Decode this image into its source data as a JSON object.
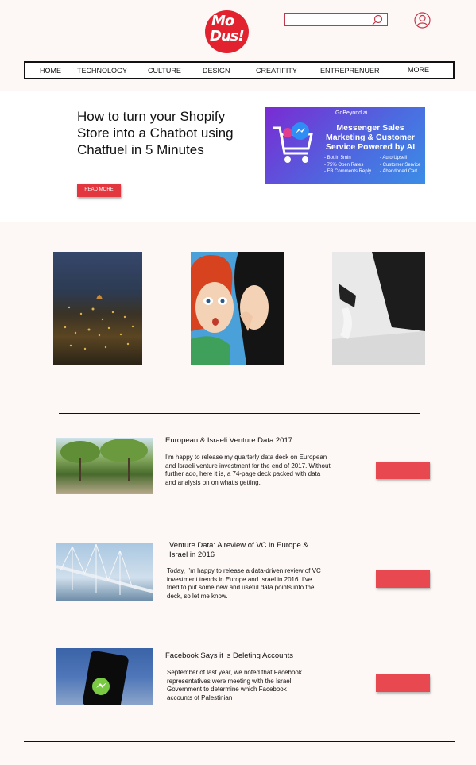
{
  "logo": {
    "line1": "Mo",
    "line2": "Dus!"
  },
  "search": {
    "placeholder": "",
    "value": ""
  },
  "nav": {
    "items": [
      "HOME",
      "TECHNOLOGY",
      "CULTURE",
      "DESIGN",
      "CREATIFITY",
      "ENTREPRENUER",
      "MORE"
    ]
  },
  "hero": {
    "title": "How to turn your Shopify Store into a Chatbot using Chatfuel in 5 Minutes",
    "read_more": "READ MORE",
    "promo": {
      "brand": "GoBeyond.ai",
      "headline": "Messenger Sales Marketing & Customer Service Powered by AI",
      "features_left": [
        "- Bot in 5min",
        "- 75% Open Rates",
        "- FB Comments Reply"
      ],
      "features_right": [
        "- Auto Upsell",
        "- Customer Service",
        "- Abandoned Cart"
      ]
    }
  },
  "articles": [
    {
      "title": "European & Israeli Venture Data 2017",
      "body": "I’m happy to release my quarterly data deck on European and Israeli venture investment for the end of 2017. Without further ado, here it is, a 74-page deck packed with data and analysis on on what's getting."
    },
    {
      "title": "Venture Data: A review of VC in Europe & Israel in 2016",
      "body": "Today, I’m happy to release a data-driven review of VC investment trends in Europe and Israel in 2016. I’ve tried to put some new and useful data points into the deck, so let me know."
    },
    {
      "title": "Facebook Says it is Deleting Accounts",
      "body": "September of last year, we noted that Facebook representatives were meeting with the Israeli Government to determine which Facebook accounts of Palestinian"
    }
  ],
  "colors": {
    "accent": "#e2222f",
    "button": "#e8484f",
    "background": "#fdf7f5"
  }
}
